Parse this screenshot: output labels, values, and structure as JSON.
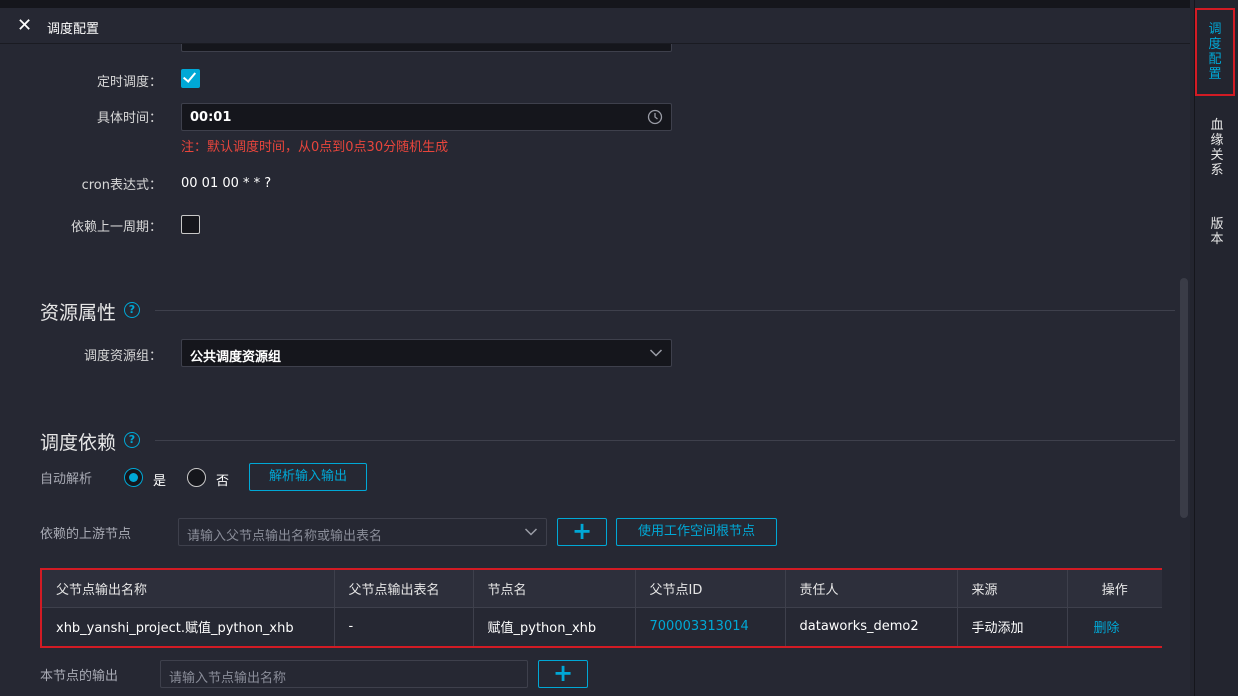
{
  "panel": {
    "title": "调度配置"
  },
  "schedule": {
    "timed_label": "定时调度：",
    "time_label": "具体时间：",
    "time_value": "00:01",
    "time_note": "注：默认调度时间，从0点到0点30分随机生成",
    "cron_label": "cron表达式：",
    "cron_value": "00 01 00 * * ?",
    "depend_prev_label": "依赖上一周期："
  },
  "resource": {
    "section_title": "资源属性",
    "group_label": "调度资源组：",
    "group_value": "公共调度资源组"
  },
  "dependency": {
    "section_title": "调度依赖",
    "auto_parse_label": "自动解析",
    "yes_label": "是",
    "no_label": "否",
    "parse_button": "解析输入输出",
    "upstream_label": "依赖的上游节点",
    "upstream_placeholder": "请输入父节点输出名称或输出表名",
    "root_button": "使用工作空间根节点",
    "output_label": "本节点的输出",
    "output_placeholder": "请输入节点输出名称",
    "table": {
      "headers": [
        "父节点输出名称",
        "父节点输出表名",
        "节点名",
        "父节点ID",
        "责任人",
        "来源",
        "操作"
      ],
      "rows": [
        [
          "xhb_yanshi_project.赋值_python_xhb",
          "-",
          "赋值_python_xhb",
          "700003313014",
          "dataworks_demo2",
          "手动添加",
          "删除"
        ]
      ]
    }
  },
  "sidebar": {
    "tabs": [
      "调度配置",
      "血缘关系",
      "版本"
    ]
  },
  "colors": {
    "accent": "#00a8d6",
    "highlight": "#d21b24",
    "note": "#e8453c"
  }
}
